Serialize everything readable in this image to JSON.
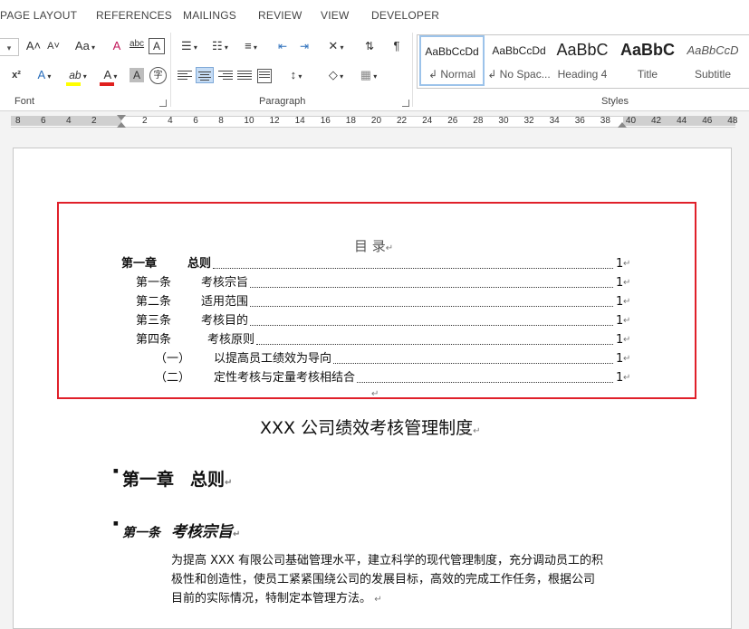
{
  "tabs": [
    "PAGE LAYOUT",
    "REFERENCES",
    "MAILINGS",
    "REVIEW",
    "VIEW",
    "DEVELOPER"
  ],
  "ribbon": {
    "font_group": "Font",
    "paragraph_group": "Paragraph",
    "styles_group": "Styles",
    "font_grow": "A˄",
    "font_shrink": "A˅",
    "change_case": "Aa",
    "clear_format": "A",
    "superscript": "x²",
    "text_effects": "A",
    "highlight": "ab",
    "font_color": "A",
    "char_shading": "A",
    "enclose": "字",
    "highlight_color": "#ffff00",
    "font_color_value": "#e0201e"
  },
  "styles": [
    {
      "preview": "AaBbCcDd",
      "name": "↲ Normal"
    },
    {
      "preview": "AaBbCcDd",
      "name": "↲ No Spac..."
    },
    {
      "preview": "AaBbC",
      "name": "Heading 4"
    },
    {
      "preview": "AaBbC",
      "name": "Title"
    },
    {
      "preview": "AaBbCcD",
      "name": "Subtitle"
    }
  ],
  "ruler": {
    "left": [
      "8",
      "6",
      "4",
      "2"
    ],
    "right": [
      "2",
      "4",
      "6",
      "8",
      "10",
      "12",
      "14",
      "16",
      "18",
      "20",
      "22",
      "24",
      "26",
      "28",
      "30",
      "32",
      "34",
      "36",
      "38",
      "40",
      "42",
      "44",
      "46",
      "48"
    ]
  },
  "toc": {
    "title": "目 录",
    "entries": [
      {
        "num": "第一章",
        "text": "总则",
        "page": "1"
      },
      {
        "num": "第一条",
        "text": "考核宗旨",
        "page": "1"
      },
      {
        "num": "第二条",
        "text": "适用范围",
        "page": "1"
      },
      {
        "num": "第三条",
        "text": "考核目的",
        "page": "1"
      },
      {
        "num": "第四条",
        "text": "考核原则",
        "page": "1"
      },
      {
        "num": "（一）",
        "text": "以提高员工绩效为导向",
        "page": "1"
      },
      {
        "num": "（二）",
        "text": "定性考核与定量考核相结合",
        "page": "1"
      }
    ]
  },
  "doc": {
    "title": "XXX 公司绩效考核管理制度",
    "chapter_num": "第一章",
    "chapter_title": "总则",
    "article_num": "第一条",
    "article_title": "考核宗旨",
    "para_lines": [
      "为提高 XXX 有限公司基础管理水平，建立科学的现代管理制度，充分调动员工的积",
      "极性和创造性，使员工紧紧围绕公司的发展目标，高效的完成工作任务，根据公司",
      "目前的实际情况，特制定本管理方法。"
    ]
  }
}
